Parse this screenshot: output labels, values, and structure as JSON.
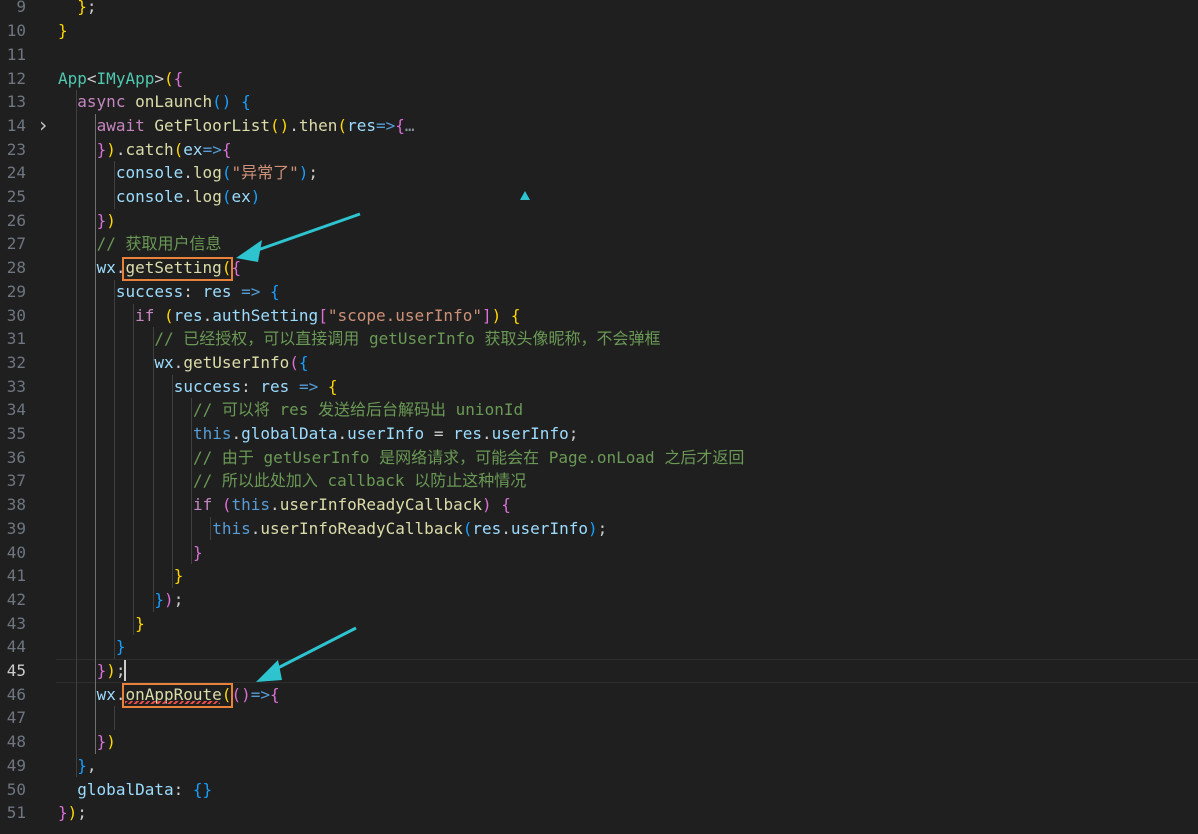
{
  "editor": {
    "lines": [
      {
        "num": "9",
        "text": "  };"
      },
      {
        "num": "10",
        "text": "}"
      },
      {
        "num": "11",
        "text": ""
      },
      {
        "num": "12",
        "text": "App<IMyApp>({"
      },
      {
        "num": "13",
        "text": "  async onLaunch() {"
      },
      {
        "num": "14",
        "text": "    await GetFloorList().then(res=>{…"
      },
      {
        "num": "23",
        "text": "    }).catch(ex=>{"
      },
      {
        "num": "24",
        "text": "      console.log(\"异常了\");"
      },
      {
        "num": "25",
        "text": "      console.log(ex)"
      },
      {
        "num": "26",
        "text": "    })"
      },
      {
        "num": "27",
        "text": "    // 获取用户信息"
      },
      {
        "num": "28",
        "text": "    wx.getSetting({"
      },
      {
        "num": "29",
        "text": "      success: res => {"
      },
      {
        "num": "30",
        "text": "        if (res.authSetting[\"scope.userInfo\"]) {"
      },
      {
        "num": "31",
        "text": "          // 已经授权，可以直接调用 getUserInfo 获取头像昵称，不会弹框"
      },
      {
        "num": "32",
        "text": "          wx.getUserInfo({"
      },
      {
        "num": "33",
        "text": "            success: res => {"
      },
      {
        "num": "34",
        "text": "              // 可以将 res 发送给后台解码出 unionId"
      },
      {
        "num": "35",
        "text": "              this.globalData.userInfo = res.userInfo;"
      },
      {
        "num": "36",
        "text": "              // 由于 getUserInfo 是网络请求，可能会在 Page.onLoad 之后才返回"
      },
      {
        "num": "37",
        "text": "              // 所以此处加入 callback 以防止这种情况"
      },
      {
        "num": "38",
        "text": "              if (this.userInfoReadyCallback) {"
      },
      {
        "num": "39",
        "text": "                this.userInfoReadyCallback(res.userInfo);"
      },
      {
        "num": "40",
        "text": "              }"
      },
      {
        "num": "41",
        "text": "            }"
      },
      {
        "num": "42",
        "text": "          });"
      },
      {
        "num": "43",
        "text": "        }"
      },
      {
        "num": "44",
        "text": "      }"
      },
      {
        "num": "45",
        "text": "    });"
      },
      {
        "num": "46",
        "text": "    wx.onAppRoute(()=>{"
      },
      {
        "num": "47",
        "text": ""
      },
      {
        "num": "48",
        "text": "    })"
      },
      {
        "num": "49",
        "text": "  },"
      },
      {
        "num": "50",
        "text": "  globalData: {}"
      },
      {
        "num": "51",
        "text": "});"
      }
    ],
    "active_line": "45",
    "folded_line": "14",
    "fold_icon": "chevron-right-icon",
    "highlighted_tokens": [
      "getSetting(",
      "onAppRoute("
    ],
    "error_token": "onAppRoute",
    "annotation_color": "#2ec4cf",
    "highlight_color": "#e8823b",
    "error_color": "#f14c4c"
  }
}
